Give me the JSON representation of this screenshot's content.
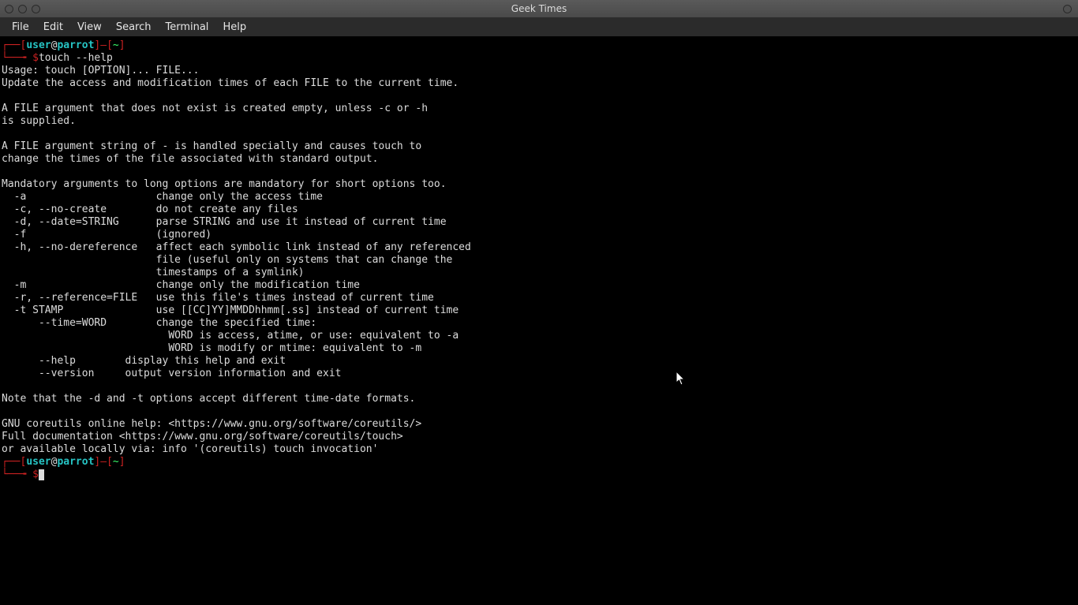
{
  "window": {
    "title": "Geek Times"
  },
  "menu": {
    "file": "File",
    "edit": "Edit",
    "view": "View",
    "search": "Search",
    "terminal": "Terminal",
    "help": "Help"
  },
  "prompt": {
    "user": "user",
    "at": "@",
    "host": "parrot",
    "dir": "~",
    "open_br": "[",
    "close_br": "]",
    "dash": "—",
    "corner_top": "┌──",
    "corner_bot": "└──╼ ",
    "dollar": "$"
  },
  "cmd": {
    "line": "touch --help"
  },
  "out": {
    "l01": "Usage: touch [OPTION]... FILE...",
    "l02": "Update the access and modification times of each FILE to the current time.",
    "l03": "",
    "l04": "A FILE argument that does not exist is created empty, unless -c or -h",
    "l05": "is supplied.",
    "l06": "",
    "l07": "A FILE argument string of - is handled specially and causes touch to",
    "l08": "change the times of the file associated with standard output.",
    "l09": "",
    "l10": "Mandatory arguments to long options are mandatory for short options too.",
    "l11": "  -a                     change only the access time",
    "l12": "  -c, --no-create        do not create any files",
    "l13": "  -d, --date=STRING      parse STRING and use it instead of current time",
    "l14": "  -f                     (ignored)",
    "l15": "  -h, --no-dereference   affect each symbolic link instead of any referenced",
    "l16": "                         file (useful only on systems that can change the",
    "l17": "                         timestamps of a symlink)",
    "l18": "  -m                     change only the modification time",
    "l19": "  -r, --reference=FILE   use this file's times instead of current time",
    "l20": "  -t STAMP               use [[CC]YY]MMDDhhmm[.ss] instead of current time",
    "l21": "      --time=WORD        change the specified time:",
    "l22": "                           WORD is access, atime, or use: equivalent to -a",
    "l23": "                           WORD is modify or mtime: equivalent to -m",
    "l24": "      --help        display this help and exit",
    "l25": "      --version     output version information and exit",
    "l26": "",
    "l27": "Note that the -d and -t options accept different time-date formats.",
    "l28": "",
    "l29": "GNU coreutils online help: <https://www.gnu.org/software/coreutils/>",
    "l30": "Full documentation <https://www.gnu.org/software/coreutils/touch>",
    "l31": "or available locally via: info '(coreutils) touch invocation'"
  }
}
